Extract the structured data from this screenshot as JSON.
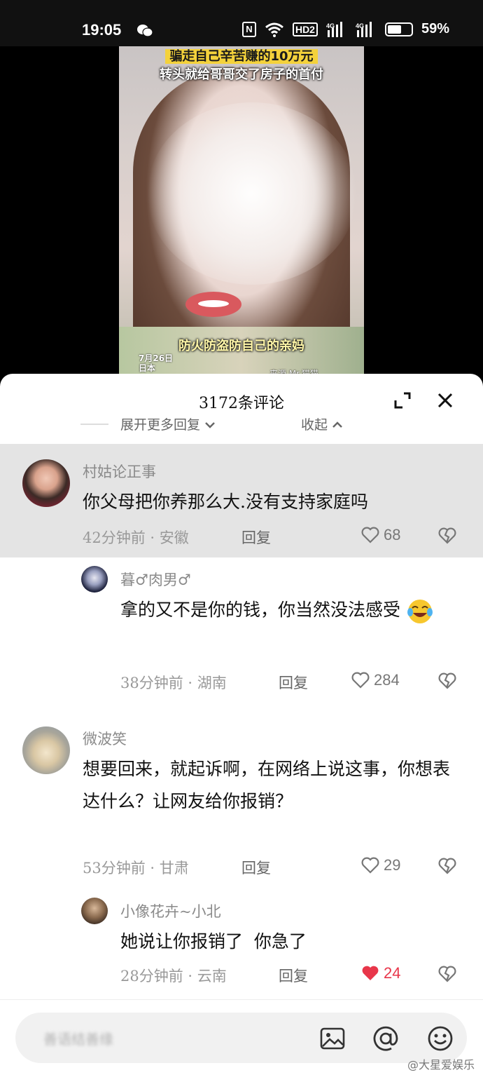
{
  "status_bar": {
    "time": "19:05",
    "network_labels": [
      "4G",
      "4G"
    ],
    "hd_label": "HD2",
    "nfc_label": "N",
    "battery": "59%",
    "battery_level": 0.59
  },
  "video": {
    "caption_top": "骗走自己辛苦赚的10万元",
    "caption_second": "转头就给哥哥交了房子的首付",
    "caption_bottom": "防火防盗防自己的亲妈",
    "date": "7月26日",
    "location": "日本",
    "source": "来源 Mr.猫猫"
  },
  "panel": {
    "title": "3172条评论",
    "expand_replies": "展开更多回复",
    "collapse": "收起"
  },
  "comments": [
    {
      "author": "村姑论正事",
      "text": "你父母把你养那么大.没有支持家庭吗",
      "time": "42分钟前",
      "region": "安徽",
      "reply": "回复",
      "likes": "68"
    },
    {
      "author": "暮♂肉男♂",
      "text": "拿的又不是你的钱，你当然没法感受",
      "time": "38分钟前",
      "region": "湖南",
      "reply": "回复",
      "likes": "284"
    },
    {
      "author": "微波笑",
      "text": "想要回来，就起诉啊，在网络上说这事，你想表达什么？让网友给你报销？",
      "time": "53分钟前",
      "region": "甘肃",
      "reply": "回复",
      "likes": "29"
    },
    {
      "author": "小像花卉~小北",
      "text": "她说让你报销了  你急了",
      "time": "28分钟前",
      "region": "云南",
      "reply": "回复",
      "likes": "24"
    }
  ],
  "input": {
    "placeholder": "善语结善缘"
  },
  "watermark": "@大星爱娱乐",
  "colors": {
    "liked": "#e8364a",
    "highlight_bg": "#e4e4e4"
  }
}
